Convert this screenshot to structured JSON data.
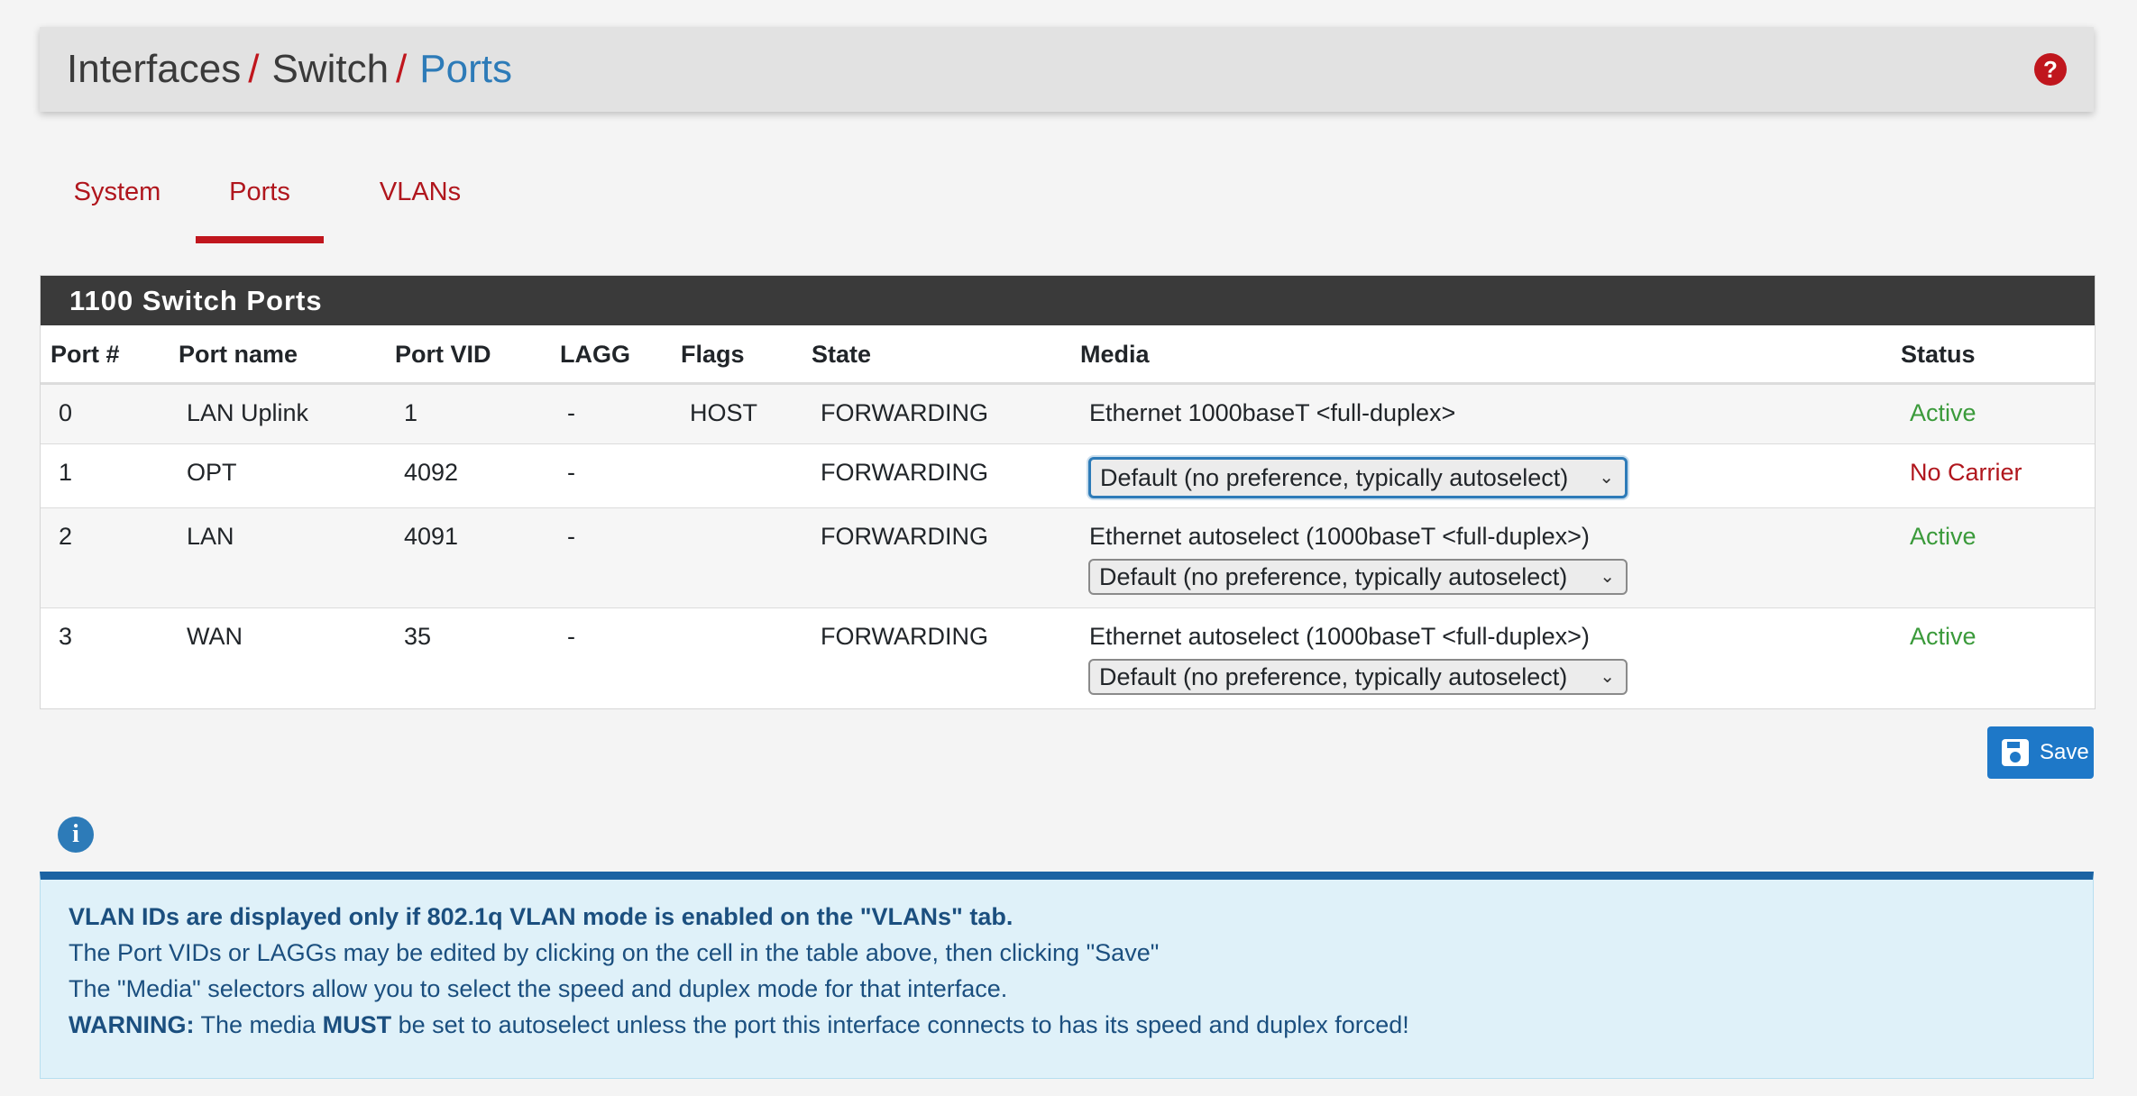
{
  "breadcrumb": {
    "items": [
      "Interfaces",
      "Switch",
      "Ports"
    ],
    "separator": "/"
  },
  "help_icon": {
    "name": "help-icon",
    "glyph": "?"
  },
  "tabs": [
    {
      "label": "System",
      "active": false
    },
    {
      "label": "Ports",
      "active": true
    },
    {
      "label": "VLANs",
      "active": false
    }
  ],
  "panel": {
    "title": "1100 Switch Ports",
    "columns": [
      "Port #",
      "Port name",
      "Port VID",
      "LAGG",
      "Flags",
      "State",
      "Media",
      "Status"
    ],
    "rows": [
      {
        "port": "0",
        "name": "LAN Uplink",
        "vid": "1",
        "lagg": "-",
        "flags": "HOST",
        "state": "FORWARDING",
        "media_text": "Ethernet 1000baseT <full-duplex>",
        "media_select": "",
        "status": "Active"
      },
      {
        "port": "1",
        "name": "OPT",
        "vid": "4092",
        "lagg": "-",
        "flags": "",
        "state": "FORWARDING",
        "media_text": "",
        "media_select": "Default (no preference, typically autoselect)",
        "status": "No Carrier"
      },
      {
        "port": "2",
        "name": "LAN",
        "vid": "4091",
        "lagg": "-",
        "flags": "",
        "state": "FORWARDING",
        "media_text": "Ethernet autoselect (1000baseT <full-duplex>)",
        "media_select": "Default (no preference, typically autoselect)",
        "status": "Active"
      },
      {
        "port": "3",
        "name": "WAN",
        "vid": "35",
        "lagg": "-",
        "flags": "",
        "state": "FORWARDING",
        "media_text": "Ethernet autoselect (1000baseT <full-duplex>)",
        "media_select": "Default (no preference, typically autoselect)",
        "status": "Active"
      }
    ]
  },
  "save_button": {
    "label": "Save",
    "icon": "floppy-disk-icon"
  },
  "info": {
    "icon": "info-icon",
    "glyph": "i",
    "line1": "VLAN IDs are displayed only if 802.1q VLAN mode is enabled on the \"VLANs\" tab.",
    "line2": "The Port VIDs or LAGGs may be edited by clicking on the cell in the table above, then clicking \"Save\"",
    "line3": "The \"Media\" selectors allow you to select the speed and duplex mode for that interface.",
    "line4_bold1": "WARNING:",
    "line4_part1": " The media ",
    "line4_bold2": "MUST",
    "line4_part2": " be set to autoselect unless the port this interface connects to has its speed and duplex forced!"
  },
  "colors": {
    "accent_red": "#c0161d",
    "link_blue": "#2d7bb8",
    "status_active": "#3a9a3a",
    "status_no_carrier": "#b0161d",
    "panel_heading": "#3a3a3a",
    "save_button": "#1e78c8",
    "info_background": "#dff1f9",
    "info_border": "#1b63a3"
  }
}
